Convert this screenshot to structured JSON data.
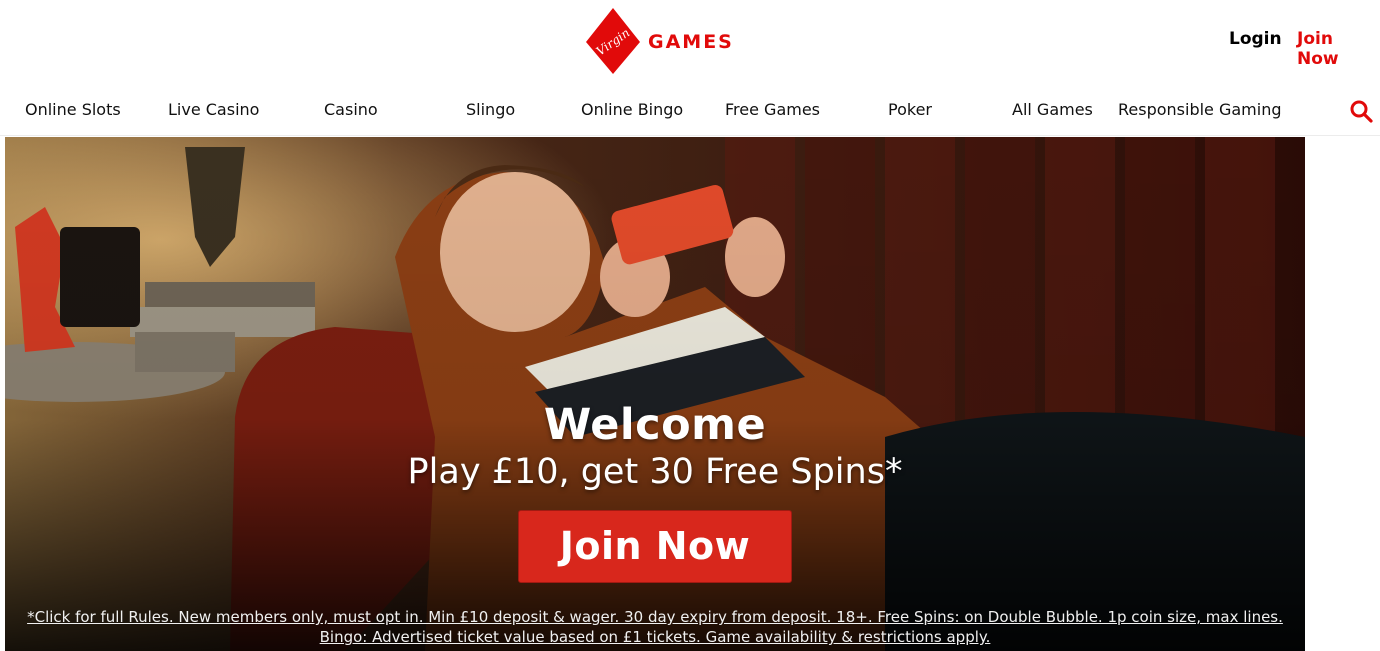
{
  "brand": {
    "logo_script": "Virgin",
    "logo_word": "GAMES",
    "red": "#e10a0a"
  },
  "header": {
    "login_label": "Login",
    "join_label": "Join Now"
  },
  "nav": {
    "items": [
      "Online Slots",
      "Live Casino",
      "Casino",
      "Slingo",
      "Online Bingo",
      "Free Games",
      "Poker",
      "All Games",
      "Responsible Gaming"
    ],
    "search_icon": "search-icon"
  },
  "hero": {
    "title": "Welcome",
    "subtitle": "Play £10, get 30 Free Spins*",
    "cta_label": "Join Now",
    "cta_color": "#d8271c",
    "terms_text": "*Click for full Rules. New members only, must opt in. Min £10 deposit & wager. 30 day expiry from deposit. 18+. Free Spins: on Double Bubble. 1p coin size, max lines. Bingo: Advertised ticket value based on £1 tickets. Game availability & restrictions apply."
  }
}
